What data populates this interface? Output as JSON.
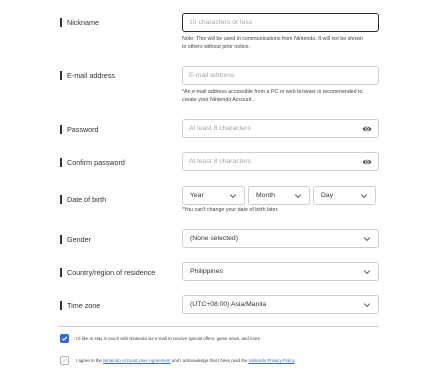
{
  "nickname": {
    "label": "Nickname",
    "placeholder": "10 characters or less",
    "note_line1": "Note: This will be used in communications from Nintendo. It will not be shown",
    "note_line2": "to others without prior notice."
  },
  "email": {
    "label": "E-mail address",
    "placeholder": "E-mail address",
    "note_line1": "*An e-mail address accessible from a PC or web browser is recommended to",
    "note_line2": "create your Nintendo Account."
  },
  "password": {
    "label": "Password",
    "placeholder": "At least 8 characters",
    "icon": "eye-icon"
  },
  "confirm_password": {
    "label": "Confirm password",
    "placeholder": "At least 8 characters",
    "icon": "eye-icon"
  },
  "dob": {
    "label": "Date of birth",
    "year": "Year",
    "month": "Month",
    "day": "Day",
    "note": "*You can't change your date of birth later."
  },
  "gender": {
    "label": "Gender",
    "value": "(None selected)"
  },
  "country": {
    "label": "Country/region of residence",
    "value": "Philippines"
  },
  "timezone": {
    "label": "Time zone",
    "value": "(UTC+08:00) Asia/Manila"
  },
  "consent": {
    "newsletter_checked": true,
    "newsletter_text": "I'd like to stay in touch with Nintendo via e-mail to receive special offers, game news, and more.",
    "agree_checked": false,
    "agree_prefix": "I agree to the ",
    "agree_link1": "Nintendo Account User Agreement",
    "agree_middle": " and I acknowledge that I have read the ",
    "agree_link2": "Nintendo Privacy Policy",
    "agree_suffix": "."
  },
  "colors": {
    "accent": "#2f6bd6",
    "border": "#cfcfcf",
    "text": "#333333"
  }
}
